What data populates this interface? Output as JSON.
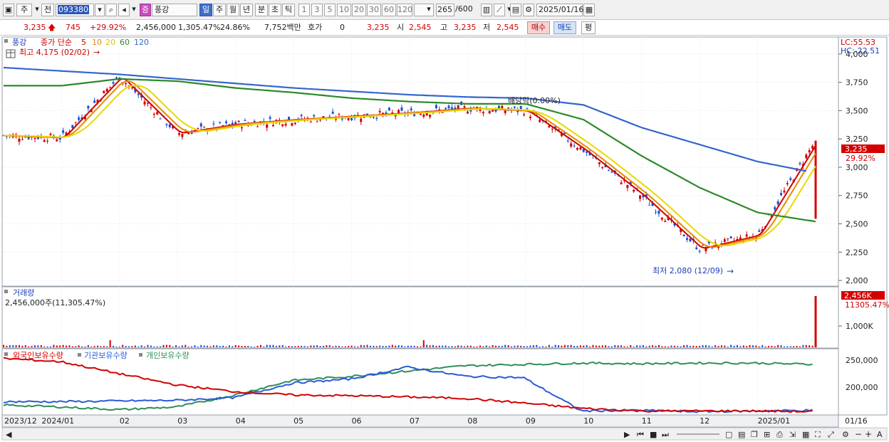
{
  "toolbar": {
    "mode_label": "주",
    "prev_label": "전",
    "code_value": "093380",
    "stock_badge": "증",
    "stock_name": "풍강",
    "periods": [
      "일",
      "주",
      "월",
      "년",
      "분",
      "초",
      "틱"
    ],
    "active_period": "일",
    "intervals": [
      "1",
      "3",
      "5",
      "10",
      "20",
      "30",
      "60",
      "120"
    ],
    "count_value": "265",
    "count_total": "/600",
    "date_value": "2025/01/16"
  },
  "quote": {
    "price": "3,235",
    "change": "745",
    "change_pct": "+29.92%",
    "volume": "2,456,000",
    "volume_pct": "1,305.47%",
    "turnover": "24.86%",
    "amount": "7,752백만",
    "hoga_label": "호가",
    "hoga_value": "0",
    "ask": "3,235",
    "open_label": "시",
    "open": "2,545",
    "high_label": "고",
    "high": "3,235",
    "low_label": "저",
    "low": "2,545",
    "buy_label": "매수",
    "sell_label": "매도",
    "eval_label": "평"
  },
  "price_panel": {
    "tag": "풍강",
    "legend_title": "종가 단순",
    "ma_periods": [
      "5",
      "10",
      "20",
      "60",
      "120"
    ],
    "ma_colors": [
      "#cc0000",
      "#e88a00",
      "#e8d800",
      "#2a8a2a",
      "#3366cc"
    ],
    "high_marker": "최고 4,175 (02/02)",
    "low_marker": "최저 2,080 (12/09)",
    "dividend_marker": "배당락(0.00%)",
    "lc": "LC:55.53",
    "hc": "HC:-22.51",
    "price_ticks": [
      "4,000",
      "3,750",
      "3,500",
      "3,250",
      "3,000",
      "2,750",
      "2,500",
      "2,250",
      "2,000"
    ],
    "current_price": "3,235",
    "current_pct": "29.92%"
  },
  "volume_panel": {
    "title": "거래량",
    "info": "2,456,000주(11,305.47%)",
    "tick": "1,000K",
    "current": "2,456K",
    "current_pct": "11305.47%"
  },
  "holdings_panel": {
    "series_names": [
      "외국인보유수량",
      "기관보유수량",
      "개인보유수량"
    ],
    "series_colors": [
      "#d40000",
      "#2a5bd7",
      "#2f8f5a"
    ],
    "ticks": [
      "250,000",
      "200,000"
    ]
  },
  "xaxis": {
    "labels": [
      "2023/12",
      "2024/01",
      "02",
      "03",
      "04",
      "05",
      "06",
      "07",
      "08",
      "09",
      "10",
      "11",
      "12",
      "2025/01"
    ],
    "right_label": "01/16"
  },
  "chart_data": {
    "type": "line",
    "title": "",
    "x": [
      "2023/12",
      "2024/01",
      "02",
      "03",
      "04",
      "05",
      "06",
      "07",
      "08",
      "09",
      "10",
      "11",
      "12",
      "2025/01",
      "2025/01/16"
    ],
    "ylim": [
      1950,
      4150
    ],
    "series": [
      {
        "name": "종가",
        "values": [
          3280,
          3260,
          3800,
          3300,
          3380,
          3420,
          3450,
          3480,
          3520,
          3500,
          3150,
          2750,
          2280,
          2400,
          3235
        ]
      },
      {
        "name": "60",
        "values": [
          3720,
          3720,
          3780,
          3760,
          3700,
          3660,
          3610,
          3580,
          3560,
          3560,
          3420,
          3100,
          2820,
          2600,
          2520
        ]
      },
      {
        "name": "120",
        "values": [
          3880,
          3850,
          3820,
          3780,
          3740,
          3700,
          3670,
          3640,
          3620,
          3610,
          3550,
          3350,
          3200,
          3050,
          2950
        ]
      }
    ]
  }
}
